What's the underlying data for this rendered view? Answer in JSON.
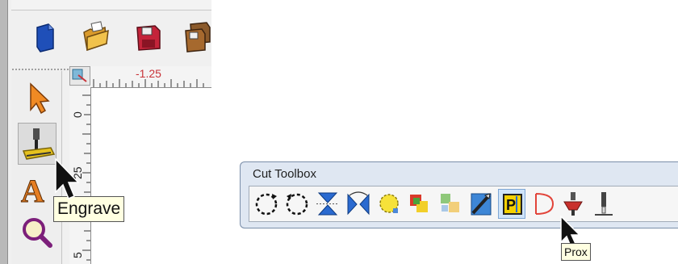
{
  "app": {
    "toolbar": {
      "buttons": [
        {
          "name": "new-document-button",
          "icon": "new-document-icon"
        },
        {
          "name": "open-folder-button",
          "icon": "open-folder-icon"
        },
        {
          "name": "save-button",
          "icon": "floppy-disk-icon"
        },
        {
          "name": "save-all-button",
          "icon": "multi-disk-icon"
        }
      ]
    },
    "tools": [
      {
        "name": "select-tool-button",
        "icon": "arrow-cursor-icon"
      },
      {
        "name": "engrave-tool-button",
        "icon": "engrave-machine-icon",
        "pressed": true
      },
      {
        "name": "text-tool-button",
        "icon": "letter-a-icon"
      },
      {
        "name": "zoom-tool-button",
        "icon": "magnifier-icon"
      }
    ],
    "ruler": {
      "horizontal_label": "-1.25",
      "vertical_labels": [
        "0",
        "25",
        "5"
      ]
    },
    "tooltip": "Engrave"
  },
  "cut_toolbox": {
    "title": "Cut Toolbox",
    "tools": [
      {
        "name": "cut-clockwise-button",
        "icon": "dashed-circle-cw-icon"
      },
      {
        "name": "cut-counterclockwise-button",
        "icon": "dashed-circle-ccw-icon"
      },
      {
        "name": "flip-vertical-button",
        "icon": "flip-vertical-icon"
      },
      {
        "name": "flip-horizontal-button",
        "icon": "flip-horizontal-icon"
      },
      {
        "name": "circle-path-button",
        "icon": "yellow-circle-icon"
      },
      {
        "name": "overlap-button",
        "icon": "overlap-squares-icon"
      },
      {
        "name": "puzzle-button",
        "icon": "puzzle-icon"
      },
      {
        "name": "knife-button",
        "icon": "knife-icon"
      },
      {
        "name": "prox-button",
        "icon": "p-box-icon",
        "active": true
      },
      {
        "name": "d-shape-button",
        "icon": "d-shape-icon"
      },
      {
        "name": "router-bit-button",
        "icon": "router-bit-icon"
      },
      {
        "name": "tool-bit-button",
        "icon": "tool-bit-icon"
      }
    ],
    "tooltip": "Prox"
  },
  "colors": {
    "ruler_label": "#c8343a",
    "tooltip_bg": "#ffffe1",
    "toolbox_frame": "#dfe7f2",
    "prox_active": "#cfe3f8"
  }
}
